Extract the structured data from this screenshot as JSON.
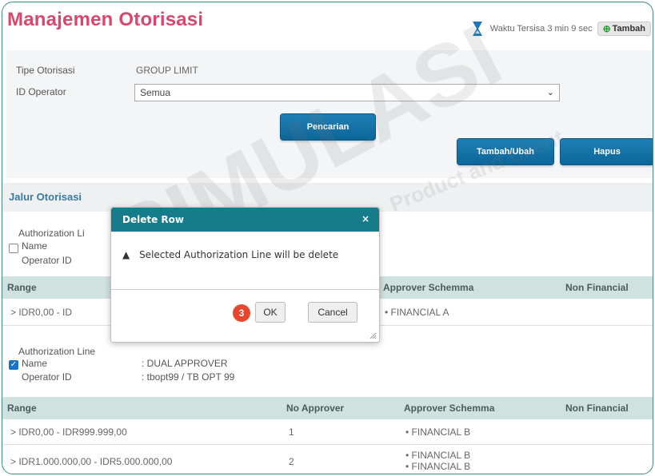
{
  "page": {
    "title": "Manajemen Otorisasi",
    "timer_text": "Waktu Tersisa 3  min 9  sec",
    "add_label": "Tambah"
  },
  "form": {
    "type_label": "Tipe Otorisasi",
    "type_value": "GROUP LIMIT",
    "operator_label": "ID Operator",
    "operator_selected": "Semua",
    "search_label": "Pencarian",
    "add_edit_label": "Tambah/Ubah",
    "delete_label": "Hapus"
  },
  "section": {
    "title": "Jalur Otorisasi"
  },
  "block1": {
    "heading": "Authorization Li",
    "name_label": "Name",
    "operator_label": "Operator ID",
    "columns": {
      "range": "Range",
      "approver_schemma": "Approver Schemma",
      "non_financial": "Non Financial"
    },
    "rows": [
      {
        "range": ">  IDR0,00  -  ID",
        "schemma": "•  FINANCIAL A"
      }
    ]
  },
  "block2": {
    "heading": "Authorization Line",
    "name_label": "Name",
    "name_value": ": DUAL APPROVER",
    "operator_label": "Operator ID",
    "operator_value": ": tbopt99 / TB OPT 99",
    "columns": {
      "range": "Range",
      "no_approver": "No Approver",
      "approver_schemma": "Approver Schemma",
      "non_financial": "Non Financial"
    },
    "rows": [
      {
        "range": ">  IDR0,00  -  IDR999.999,00",
        "no_approver": "1",
        "schemma": [
          "•  FINANCIAL B"
        ]
      },
      {
        "range": ">  IDR1.000.000,00  -  IDR5.000.000,00",
        "no_approver": "2",
        "schemma": [
          "•  FINANCIAL B",
          "•  FINANCIAL B"
        ]
      }
    ]
  },
  "modal": {
    "title": "Delete Row",
    "close": "×",
    "message": "Selected Authorization Line will be delete",
    "ok_label": "OK",
    "cancel_label": "Cancel",
    "step_badge": "3"
  },
  "watermark": {
    "text": "SIMULASI",
    "sub": "Product and Client"
  },
  "colors": {
    "title": "#d9466e",
    "modal_header": "#167b8a",
    "button": "#0c6699",
    "table_head": "#cfe2e0",
    "badge": "#e8452c"
  },
  "icons": {
    "timer": "hourglass-icon",
    "add": "plus-circle-icon",
    "warning": "warning-icon",
    "close": "close-icon",
    "dropdown": "chevron-down-icon",
    "resize": "resize-grip-icon"
  }
}
